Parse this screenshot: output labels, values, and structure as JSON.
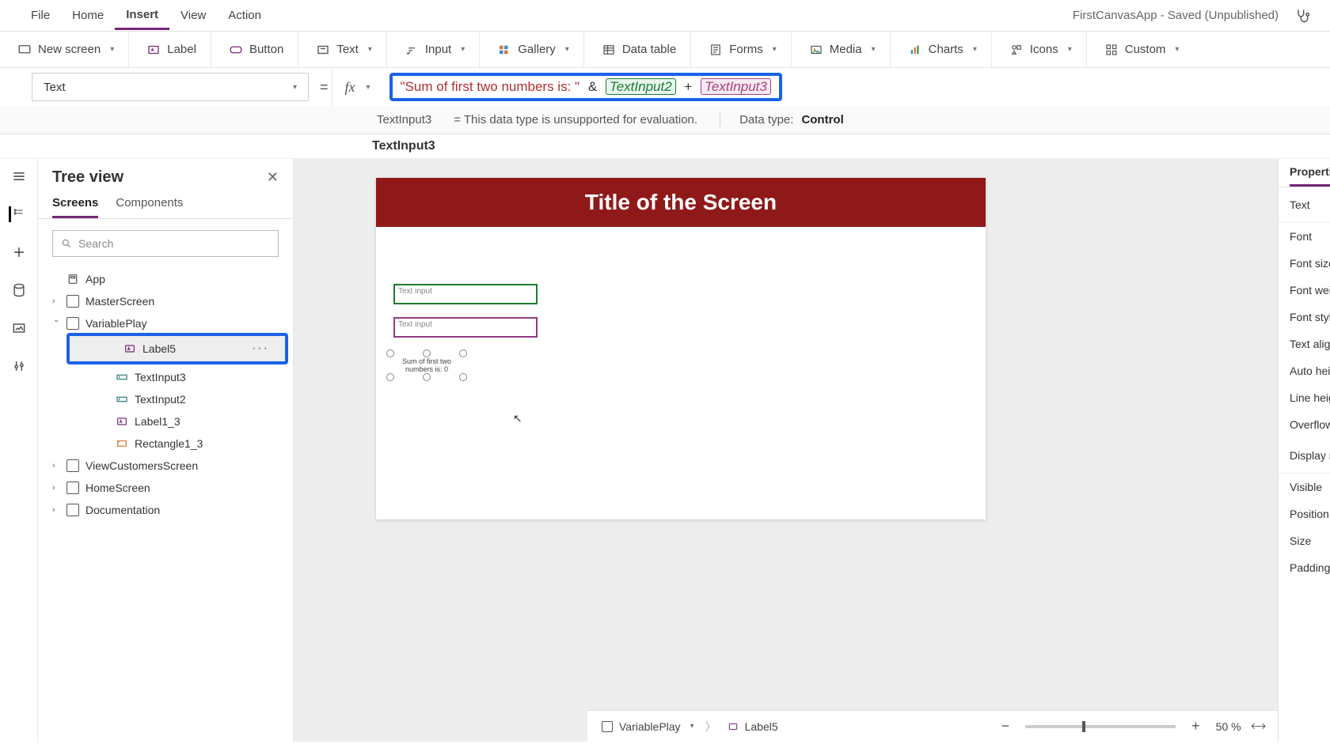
{
  "menubar": {
    "items": [
      "File",
      "Home",
      "Insert",
      "View",
      "Action"
    ],
    "active": "Insert",
    "app_title": "FirstCanvasApp - Saved (Unpublished)"
  },
  "ribbon": {
    "new_screen": "New screen",
    "label": "Label",
    "button": "Button",
    "text": "Text",
    "input": "Input",
    "gallery": "Gallery",
    "data_table": "Data table",
    "forms": "Forms",
    "media": "Media",
    "charts": "Charts",
    "icons": "Icons",
    "custom": "Custom"
  },
  "formula": {
    "property": "Text",
    "equals": "=",
    "fx": "fx",
    "string_part": "\"Sum of first two numbers is: \"",
    "amp": "&",
    "ref1": "TextInput2",
    "plus": "+",
    "ref2": "TextInput3"
  },
  "hint": {
    "left": "TextInput3",
    "mid": "=  This data type is unsupported for evaluation.",
    "dtype_label": "Data type:",
    "dtype_value": "Control",
    "element_name": "TextInput3"
  },
  "tree": {
    "title": "Tree view",
    "tabs": [
      "Screens",
      "Components"
    ],
    "search_placeholder": "Search",
    "items": {
      "app": "App",
      "master": "MasterScreen",
      "variableplay": "VariablePlay",
      "label5": "Label5",
      "textinput3": "TextInput3",
      "textinput2": "TextInput2",
      "label1_3": "Label1_3",
      "rectangle1_3": "Rectangle1_3",
      "viewcustomers": "ViewCustomersScreen",
      "homescreen": "HomeScreen",
      "documentation": "Documentation"
    }
  },
  "canvas": {
    "screen_title": "Title of the Screen",
    "textinput_placeholder": "Text input",
    "label5_text": "Sum of first two numbers is: 0"
  },
  "properties": {
    "tab": "Properties",
    "rows": [
      "Text",
      "Font",
      "Font size",
      "Font weight",
      "Font style",
      "Text alignment",
      "Auto height",
      "Line height",
      "Overflow",
      "Display mode",
      "Visible",
      "Position",
      "Size",
      "Padding"
    ]
  },
  "statusbar": {
    "crumb_screen": "VariablePlay",
    "crumb_control": "Label5",
    "zoom": "50  %"
  }
}
